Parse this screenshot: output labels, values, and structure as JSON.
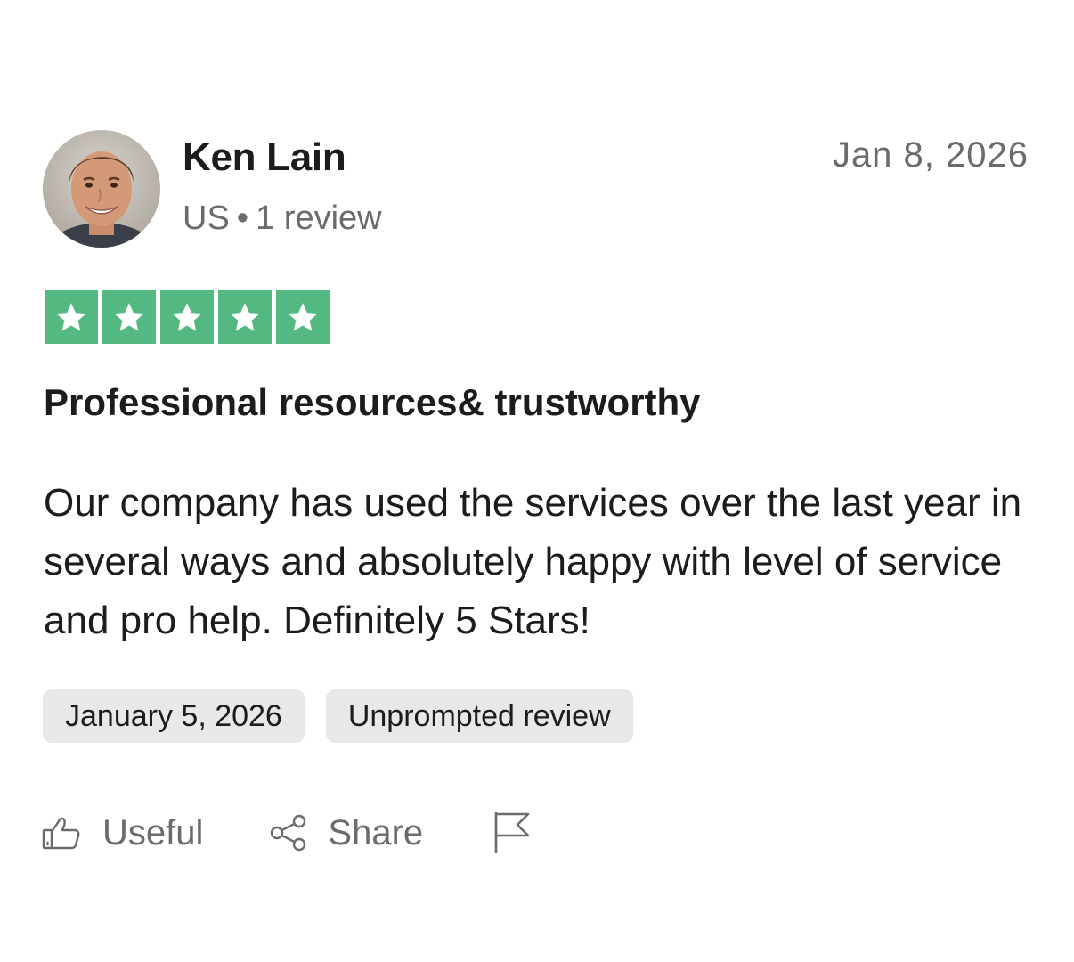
{
  "reviewer": {
    "name": "Ken Lain",
    "country": "US",
    "separator": "•",
    "review_count": "1 review"
  },
  "review": {
    "date": "Jan 8, 2026",
    "rating": 5,
    "rating_max": 5,
    "title": "Professional resources& trustworthy",
    "body": "Our company has used the services over the last year in several ways and absolutely happy with level of service and pro help. Definitely 5 Stars!",
    "experience_date": "January 5, 2026",
    "review_type": "Unprompted review"
  },
  "actions": {
    "useful_label": "Useful",
    "share_label": "Share",
    "icons": [
      "thumbs-up-icon",
      "share-icon",
      "flag-icon"
    ]
  },
  "colors": {
    "star_green": "#54b980",
    "chip_bg": "#e8e8e8",
    "muted_text": "#6b6b6b",
    "primary_text": "#1c1c1c"
  }
}
